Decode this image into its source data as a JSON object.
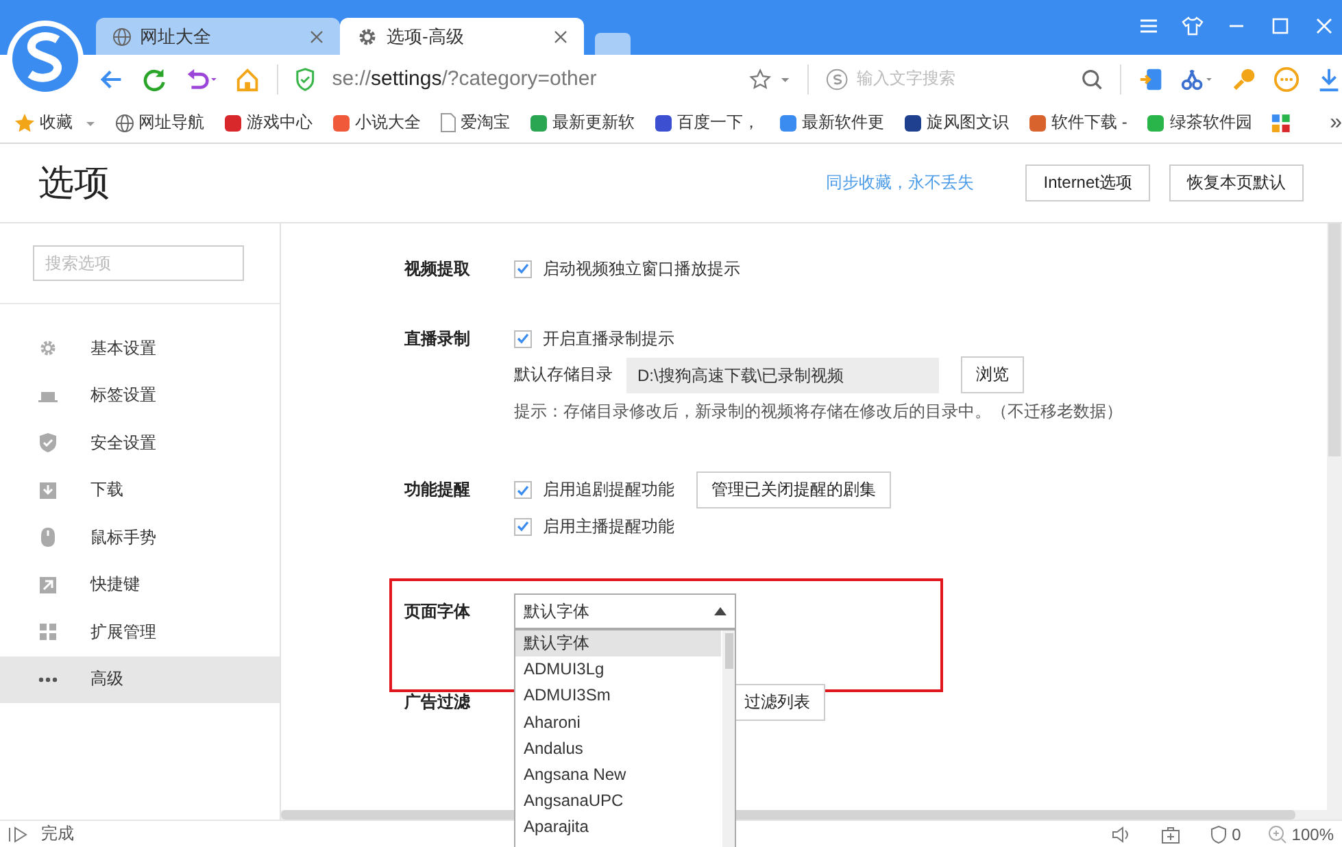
{
  "tabs": [
    {
      "label": "网址大全",
      "selected": false
    },
    {
      "label": "选项-高级",
      "selected": true
    }
  ],
  "address_bar": {
    "url": "se://**settings**/?category=other"
  },
  "search": {
    "placeholder": "输入文字搜索"
  },
  "bookmarks": [
    {
      "label": "收藏"
    },
    {
      "label": "网址导航"
    },
    {
      "label": "游戏中心"
    },
    {
      "label": "小说大全"
    },
    {
      "label": "爱淘宝"
    },
    {
      "label": "最新更新软"
    },
    {
      "label": "百度一下，"
    },
    {
      "label": "最新软件更"
    },
    {
      "label": "旋风图文识"
    },
    {
      "label": "软件下载 -"
    },
    {
      "label": "绿茶软件园"
    }
  ],
  "bookmarks_overflow": "»",
  "page": {
    "title": "选项",
    "sync_link": "同步收藏，永不丢失",
    "buttons": [
      "Internet选项",
      "恢复本页默认"
    ]
  },
  "sidebar": {
    "search_placeholder": "搜索选项",
    "items": [
      {
        "label": "基本设置",
        "selected": false
      },
      {
        "label": "标签设置",
        "selected": false
      },
      {
        "label": "安全设置",
        "selected": false
      },
      {
        "label": "下载",
        "selected": false
      },
      {
        "label": "鼠标手势",
        "selected": false
      },
      {
        "label": "快捷键",
        "selected": false
      },
      {
        "label": "扩展管理",
        "selected": false
      },
      {
        "label": "高级",
        "selected": true
      }
    ]
  },
  "sections": [
    {
      "label": "视频提取",
      "highlighted": false,
      "rows": [
        {
          "kind": "checkbox",
          "label": "启动视频独立窗口播放提示",
          "checked": true
        }
      ]
    },
    {
      "label": "直播录制",
      "highlighted": false,
      "rows": [
        {
          "kind": "checkbox",
          "label": "开启直播录制提示",
          "checked": true
        },
        {
          "kind": "directory",
          "label": "默认存储目录",
          "value": "D:\\搜狗高速下载\\已录制视频",
          "button": "浏览"
        },
        {
          "kind": "hint",
          "text": "提示：存储目录修改后，新录制的视频将存储在修改后的目录中。（不迁移老数据）"
        }
      ]
    },
    {
      "label": "功能提醒",
      "highlighted": false,
      "rows": [
        {
          "kind": "checkbox",
          "label": "启用追剧提醒功能",
          "checked": true,
          "button": "管理已关闭提醒的剧集"
        },
        {
          "kind": "checkbox",
          "label": "启用主播提醒功能",
          "checked": true
        }
      ]
    },
    {
      "label": "页面字体",
      "highlighted": true,
      "rows": [
        {
          "kind": "select",
          "value": "默认字体",
          "expanded": true,
          "options": [
            {
              "label": "默认字体",
              "selected": true
            },
            {
              "label": "ADMUI3Lg",
              "selected": false
            },
            {
              "label": "ADMUI3Sm",
              "selected": false
            },
            {
              "label": "Aharoni",
              "selected": false
            },
            {
              "label": "Andalus",
              "selected": false
            },
            {
              "label": "Angsana New",
              "selected": false
            },
            {
              "label": "AngsanaUPC",
              "selected": false
            },
            {
              "label": "Aparajita",
              "selected": false
            }
          ]
        }
      ]
    },
    {
      "label": "广告过滤",
      "highlighted": false,
      "rows": [
        {
          "kind": "button",
          "label": "过滤列表"
        }
      ]
    }
  ],
  "status_bar": {
    "text": "完成",
    "adblock_count": "0",
    "zoom": "100%"
  }
}
